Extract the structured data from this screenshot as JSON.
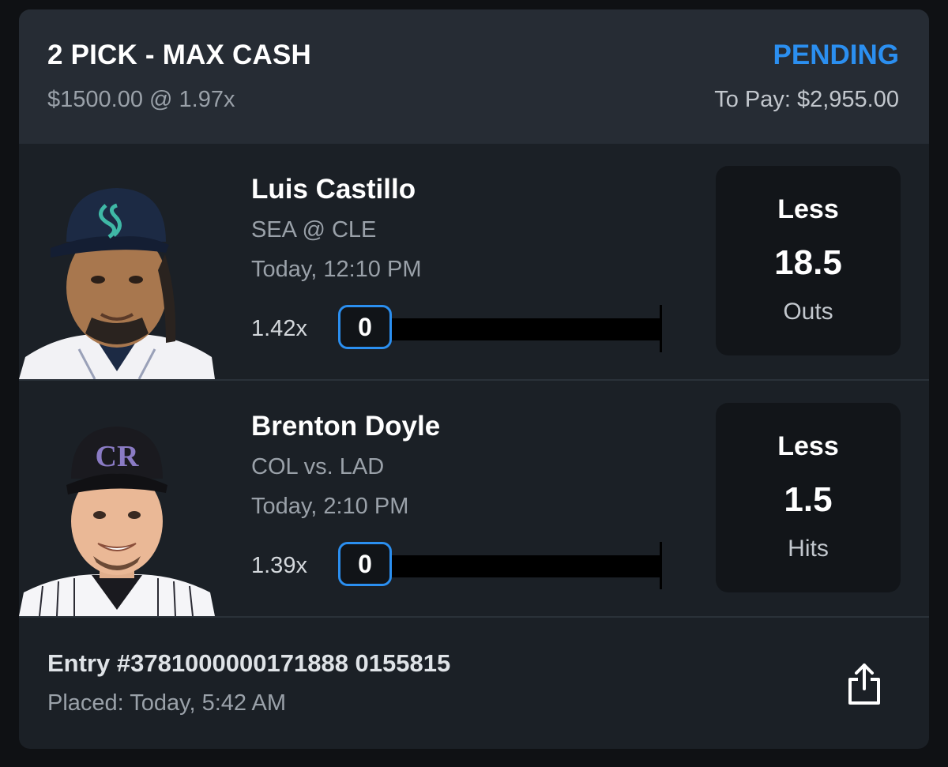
{
  "entry": {
    "title": "2 PICK - MAX CASH",
    "status": "PENDING",
    "stake": "$1500.00 @ 1.97x",
    "to_pay": "To Pay: $2,955.00"
  },
  "picks": [
    {
      "player": "Luis Castillo",
      "matchup": "SEA @ CLE",
      "time": "Today, 12:10 PM",
      "multiplier": "1.42x",
      "progress_value": "0",
      "progress_fraction": 0,
      "direction": "Less",
      "line": "18.5",
      "stat": "Outs",
      "photo_icon": "player-headshot-mariners",
      "cap_color": "#1c2a44",
      "jersey_color": "#f2f2f5"
    },
    {
      "player": "Brenton Doyle",
      "matchup": "COL vs. LAD",
      "time": "Today, 2:10 PM",
      "multiplier": "1.39x",
      "progress_value": "0",
      "progress_fraction": 0,
      "direction": "Less",
      "line": "1.5",
      "stat": "Hits",
      "photo_icon": "player-headshot-rockies",
      "cap_color": "#1a1a1f",
      "jersey_color": "#f5f5f8"
    }
  ],
  "footer": {
    "entry_id": "Entry #3781000000171888 0155815",
    "placed": "Placed: Today, 5:42 AM",
    "share_icon": "share-icon"
  },
  "colors": {
    "accent": "#2b8ff0",
    "card_bg": "#1b2026",
    "header_bg": "#262c34",
    "line_box_bg": "#121519"
  }
}
